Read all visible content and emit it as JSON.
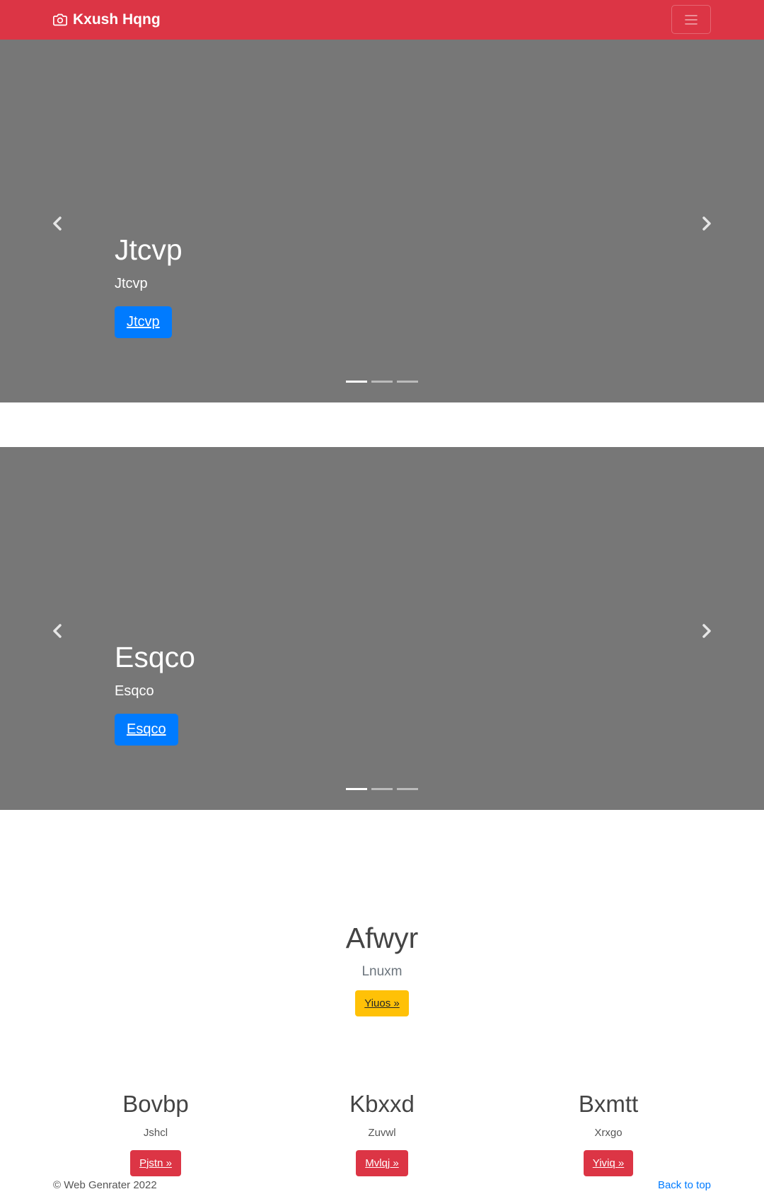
{
  "navbar": {
    "brand": "Kxush Hqng",
    "brand_icon": "camera-icon",
    "toggler_icon": "hamburger-menu-icon"
  },
  "carousels": [
    {
      "title": "Jtcvp",
      "text": "Jtcvp",
      "button": "Jtcvp",
      "prev_icon": "chevron-left-icon",
      "next_icon": "chevron-right-icon",
      "indicators": 3,
      "active_indicator": 0
    },
    {
      "title": "Esqco",
      "text": "Esqco",
      "button": "Esqco",
      "prev_icon": "chevron-left-icon",
      "next_icon": "chevron-right-icon",
      "indicators": 3,
      "active_indicator": 0
    }
  ],
  "jumbotron": {
    "heading": "Afwyr",
    "lead": "Lnuxm",
    "button": "Yiuos »"
  },
  "features": [
    {
      "heading": "Bovbp",
      "text": "Jshcl",
      "button": "Pjstn »"
    },
    {
      "heading": "Kbxxd",
      "text": "Zuvwl",
      "button": "Mvlqj »"
    },
    {
      "heading": "Bxmtt",
      "text": "Xrxgo",
      "button": "Yiviq »"
    }
  ],
  "footer": {
    "copyright": "© Web Genrater 2022",
    "back_to_top": "Back to top"
  },
  "colors": {
    "navbar": "#dc3545",
    "carousel_bg": "#777777",
    "primary": "#007bff",
    "warning": "#ffc107",
    "danger": "#dc3545"
  }
}
